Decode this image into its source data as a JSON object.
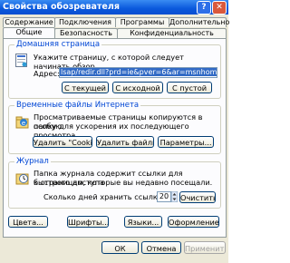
{
  "window": {
    "title": "Свойства обозревателя",
    "help_label": "?",
    "close_label": "✕"
  },
  "tabs_back": [
    "Содержание",
    "Подключения",
    "Программы",
    "Дополнительно"
  ],
  "tabs_front": [
    "Общие",
    "Безопасность",
    "Конфиденциальность"
  ],
  "home": {
    "legend": "Домашняя страница",
    "description": [
      "Укажите страницу, с которой следует начинать обзор."
    ],
    "address_label": "Адрес:",
    "address_value": "lsap/redir.dll?prd=ie&pver=6&ar=msnhome",
    "buttons": {
      "current": "С текущей",
      "default": "С исходной",
      "blank": "С пустой"
    }
  },
  "temp": {
    "legend": "Временные файлы Интернета",
    "description": [
      "Просматриваемые страницы копируются в особую",
      "папку для ускорения их последующего просмотра."
    ],
    "buttons": {
      "cookies": "Удалить \"Cookie\"...",
      "files": "Удалить файлы...",
      "settings": "Параметры..."
    }
  },
  "history": {
    "legend": "Журнал",
    "description": [
      "Папка журнала содержит ссылки для быстрого доступа",
      "к страницам, которые вы недавно посещали."
    ],
    "days_label": "Сколько дней хранить ссылки:",
    "days_value": "20",
    "clear_button": "Очистить"
  },
  "bottom_buttons": {
    "colors": "Цвета...",
    "fonts": "Шрифты...",
    "languages": "Языки...",
    "accessibility": "Оформление..."
  },
  "dialog_buttons": {
    "ok": "ОК",
    "cancel": "Отмена",
    "apply": "Применить"
  }
}
